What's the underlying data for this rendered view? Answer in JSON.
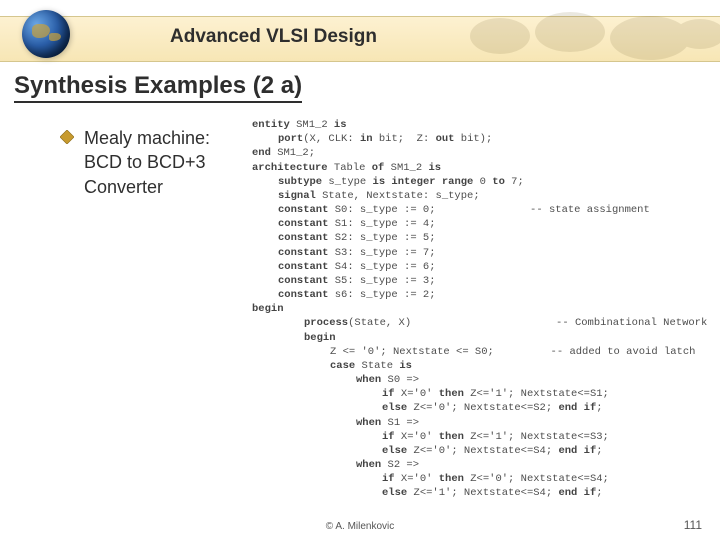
{
  "header": {
    "course_title": "Advanced VLSI Design"
  },
  "slide": {
    "title": "Synthesis Examples (2 a)"
  },
  "bullet": {
    "text": "Mealy machine: BCD to BCD+3 Converter"
  },
  "code": {
    "l01a": "entity",
    "l01b": " SM1_2 ",
    "l01c": "is",
    "l02a": "port",
    "l02b": "(X, CLK: ",
    "l02c": "in",
    "l02d": " bit;  Z: ",
    "l02e": "out",
    "l02f": " bit);",
    "l03a": "end",
    "l03b": " SM1_2;",
    "l04": "",
    "l05a": "architecture",
    "l05b": " Table ",
    "l05c": "of",
    "l05d": " SM1_2 ",
    "l05e": "is",
    "l06a": "subtype",
    "l06b": " s_type ",
    "l06c": "is integer range",
    "l06d": " 0 ",
    "l06e": "to",
    "l06f": " 7;",
    "l07a": "signal",
    "l07b": " State, Nextstate: s_type;",
    "l08a": "constant",
    "l08b": " S0: s_type := 0;",
    "l08c": "               -- state assignment",
    "l09a": "constant",
    "l09b": " S1: s_type := 4;",
    "l10a": "constant",
    "l10b": " S2: s_type := 5;",
    "l11a": "constant",
    "l11b": " S3: s_type := 7;",
    "l12a": "constant",
    "l12b": " S4: s_type := 6;",
    "l13a": "constant",
    "l13b": " S5: s_type := 3;",
    "l14a": "constant",
    "l14b": " s6: s_type := 2;",
    "l15a": "begin",
    "l16a": "process",
    "l16b": "(State, X)",
    "l16c": "                       -- Combinational Network",
    "l17a": "begin",
    "l18a": "Z <= '0'; Nextstate <= S0;",
    "l18b": "         -- added to avoid latch",
    "l19a": "case",
    "l19b": " State ",
    "l19c": "is",
    "l20a": "when",
    "l20b": " S0 =>",
    "l21a": "if",
    "l21b": " X='0' ",
    "l21c": "then",
    "l21d": " Z<='1'; Nextstate<=S1;",
    "l22a": "else",
    "l22b": " Z<='0'; Nextstate<=S2; ",
    "l22c": "end if",
    "l22d": ";",
    "l23a": "when",
    "l23b": " S1 =>",
    "l24a": "if",
    "l24b": " X='0' ",
    "l24c": "then",
    "l24d": " Z<='1'; Nextstate<=S3;",
    "l25a": "else",
    "l25b": " Z<='0'; Nextstate<=S4; ",
    "l25c": "end if",
    "l25d": ";",
    "l26a": "when",
    "l26b": " S2 =>",
    "l27a": "if",
    "l27b": " X='0' ",
    "l27c": "then",
    "l27d": " Z<='0'; Nextstate<=S4;",
    "l28a": "else",
    "l28b": " Z<='1'; Nextstate<=S4; ",
    "l28c": "end if",
    "l28d": ";"
  },
  "footer": {
    "credit": "©  A. Milenkovic",
    "page": "111"
  }
}
